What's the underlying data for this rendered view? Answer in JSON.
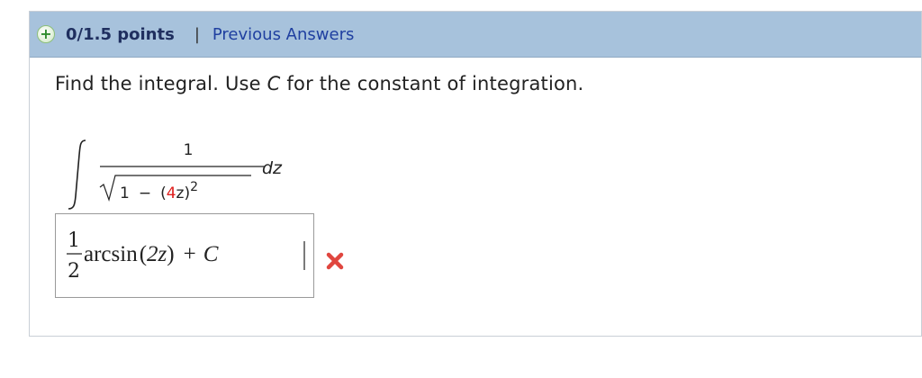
{
  "header": {
    "points": "0/1.5 points",
    "separator": "|",
    "previous_answers": "Previous Answers"
  },
  "question": {
    "text_before": "Find the integral. Use ",
    "constant_var": "C",
    "text_after": " for the constant of integration."
  },
  "integral": {
    "numerator": "1",
    "radicand_one": "1",
    "minus": "−",
    "open_paren": "(",
    "coefficient": "4",
    "variable": "z",
    "close_paren": ")",
    "exponent": "2",
    "differential": "dz"
  },
  "answer": {
    "numerator": "1",
    "denominator": "2",
    "function": "arcsin",
    "open_paren": "(",
    "argument": "2z",
    "close_paren": ")",
    "plus": "+",
    "constant": "C"
  },
  "status": {
    "result_icon": "red-x-icon",
    "wrong_color": "#e0463f"
  },
  "colors": {
    "header_bg": "#a7c2dc",
    "link": "#1f3fa0",
    "coefficient_highlight": "#e0201e"
  }
}
